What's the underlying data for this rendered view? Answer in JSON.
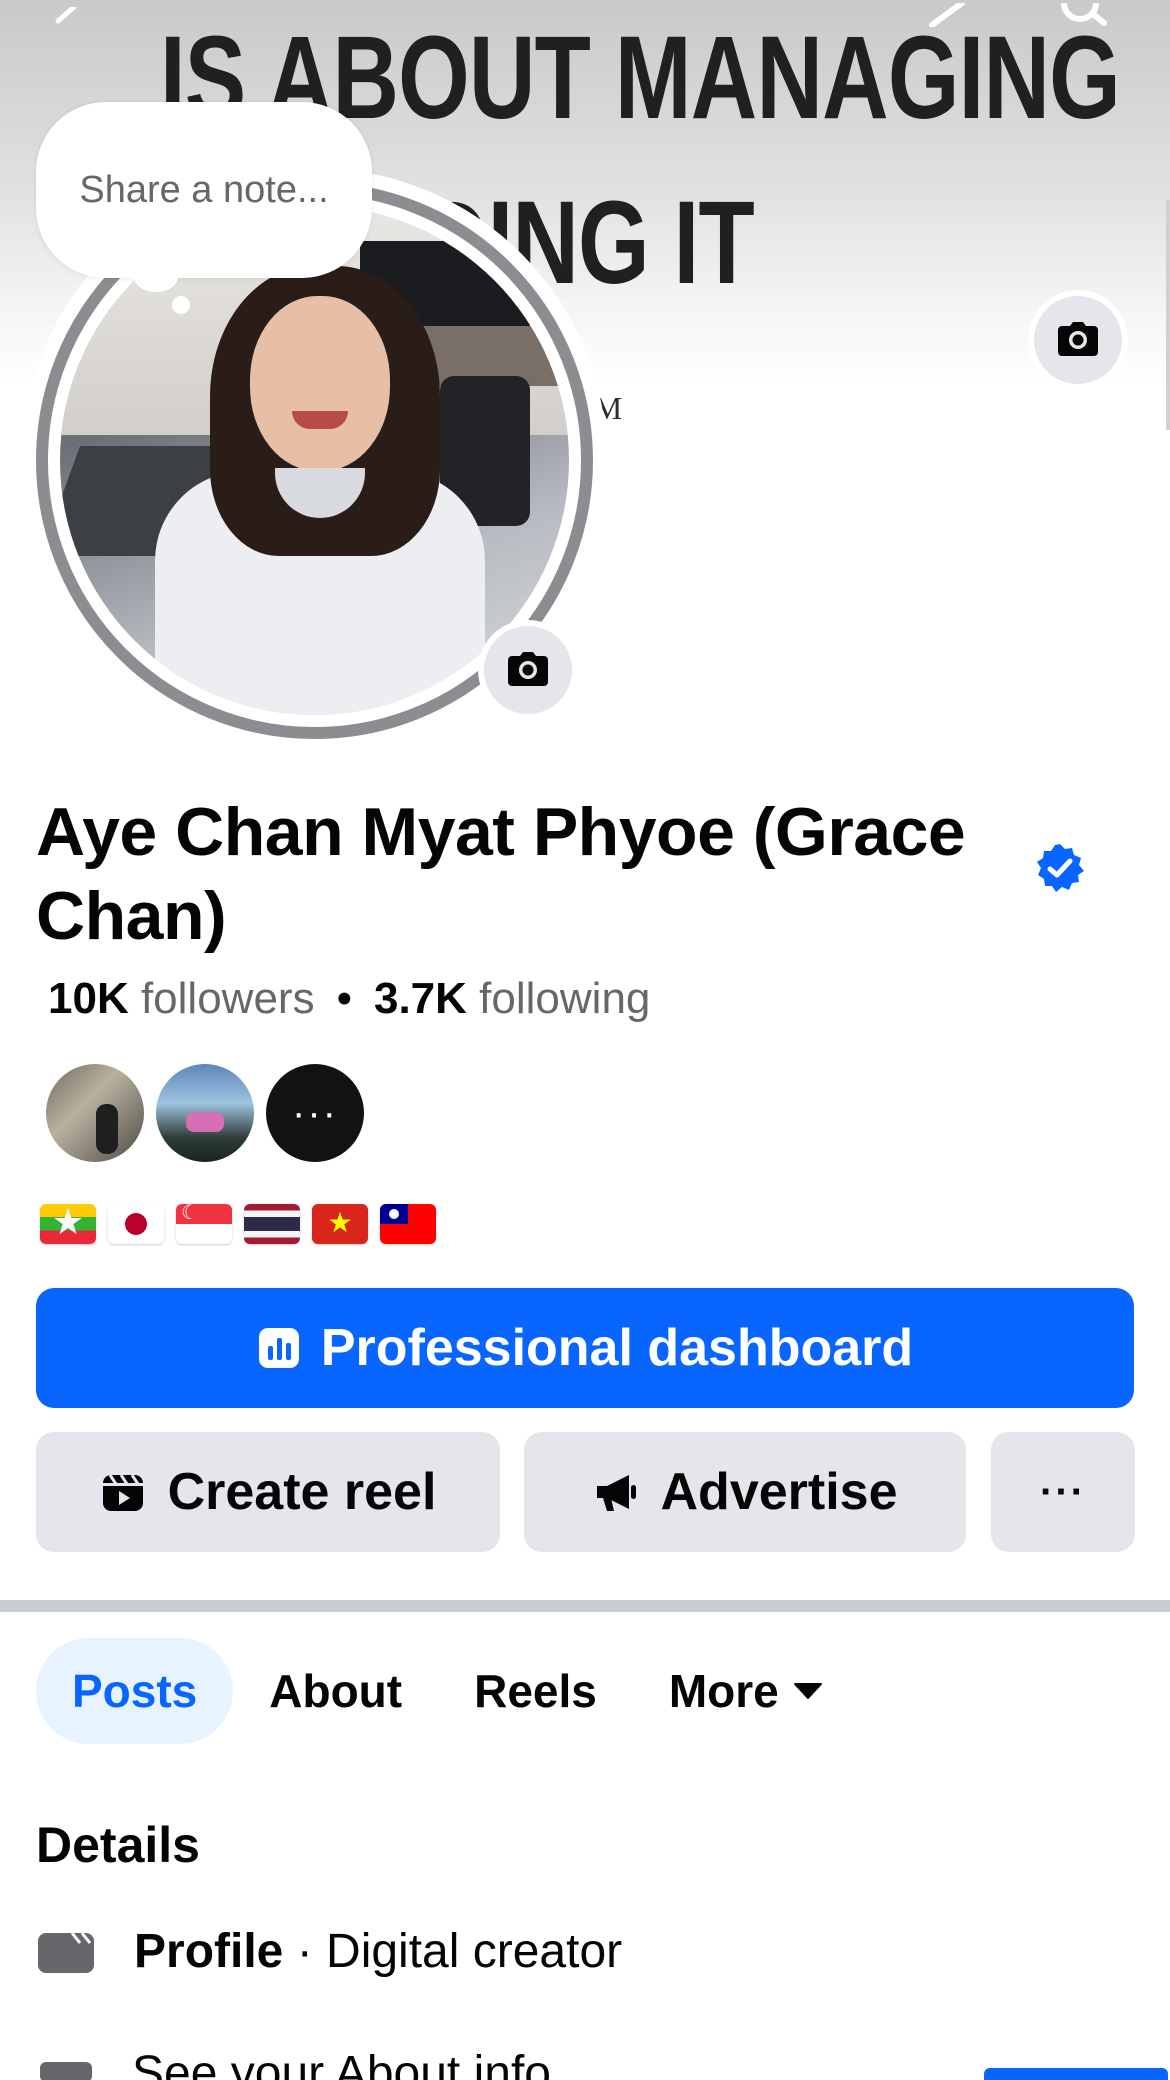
{
  "cover": {
    "line1": "IS ABOUT MANAGING",
    "line2": "T AVOIDING IT",
    "line3": "GRAHAM"
  },
  "note": {
    "placeholder": "Share a note..."
  },
  "profile": {
    "name": "Aye Chan Myat Phyoe (Grace Chan)",
    "verified": true,
    "followers_count": "10K",
    "followers_label": "followers",
    "separator": "•",
    "following_count": "3.7K",
    "following_label": "following"
  },
  "featured": {
    "more_label": "···"
  },
  "flags": [
    "myanmar-flag",
    "japan-flag",
    "singapore-flag",
    "thailand-flag",
    "vietnam-flag",
    "taiwan-flag"
  ],
  "actions": {
    "primary_label": "Professional dashboard",
    "create_reel_label": "Create reel",
    "advertise_label": "Advertise",
    "more_label": "···"
  },
  "tabs": [
    {
      "label": "Posts",
      "active": true
    },
    {
      "label": "About",
      "active": false
    },
    {
      "label": "Reels",
      "active": false
    },
    {
      "label": "More",
      "active": false
    }
  ],
  "details": {
    "title": "Details",
    "profile_bold": "Profile",
    "profile_rest": " · Digital creator",
    "about_partial": "See your About info"
  },
  "colors": {
    "accent": "#0866ff",
    "secondary_button": "#e4e6eb",
    "muted_text": "#65676b",
    "active_tab_bg": "#e7f3ff"
  }
}
